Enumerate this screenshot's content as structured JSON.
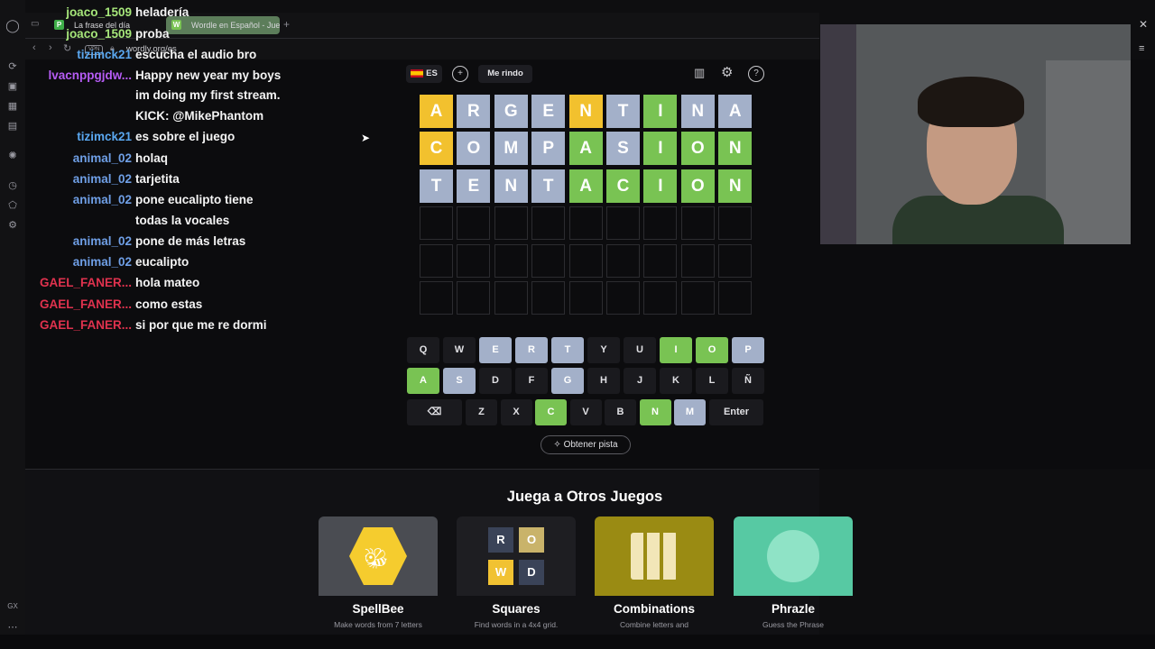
{
  "browser": {
    "tabs": [
      {
        "label": "La frase del día",
        "favicon": "P"
      },
      {
        "label": "Wordle en Español - Juego",
        "favicon": "W"
      }
    ],
    "url": "wordly.org/es",
    "vpn": "VPN",
    "gx": "GX"
  },
  "game": {
    "lang": "ES",
    "giveup": "Me rindo",
    "rows": [
      [
        "A",
        "R",
        "G",
        "E",
        "N",
        "T",
        "I",
        "N",
        "A"
      ],
      [
        "C",
        "O",
        "M",
        "P",
        "A",
        "S",
        "I",
        "O",
        "N"
      ],
      [
        "T",
        "E",
        "N",
        "T",
        "A",
        "C",
        "I",
        "O",
        "N"
      ]
    ],
    "states": [
      [
        "y",
        "g",
        "g",
        "g",
        "y",
        "g",
        "G",
        "g",
        "g"
      ],
      [
        "y",
        "g",
        "g",
        "g",
        "G",
        "g",
        "G",
        "G",
        "G"
      ],
      [
        "g",
        "g",
        "g",
        "g",
        "G",
        "G",
        "G",
        "G",
        "G"
      ]
    ],
    "keyboard": {
      "row1": [
        "Q",
        "W",
        "E",
        "R",
        "T",
        "Y",
        "U",
        "I",
        "O",
        "P"
      ],
      "row2": [
        "A",
        "S",
        "D",
        "F",
        "G",
        "H",
        "J",
        "K",
        "L",
        "Ñ"
      ],
      "row3": [
        "Z",
        "X",
        "C",
        "V",
        "B",
        "N",
        "M"
      ],
      "enter": "Enter"
    },
    "hint": "Obtener pista"
  },
  "other_games": {
    "title": "Juega a Otros Juegos",
    "cards": [
      {
        "name": "SpellBee",
        "desc": "Make words from 7 letters"
      },
      {
        "name": "Squares",
        "desc": "Find words in a 4x4 grid."
      },
      {
        "name": "Combinations",
        "desc": "Combine letters and"
      },
      {
        "name": "Phrazle",
        "desc": "Guess the Phrase"
      }
    ],
    "squares_letters": [
      "R",
      "O",
      "W",
      "D"
    ]
  },
  "chat": [
    {
      "user": "joaco_1509",
      "color": "#a6e67a",
      "text": "heladería"
    },
    {
      "user": "joaco_1509",
      "color": "#a6e67a",
      "text": "proba"
    },
    {
      "user": "tizimck21",
      "color": "#5aa7ef",
      "text": "escucha el audio bro"
    },
    {
      "user": "lvacnppgjdw...",
      "color": "#b65cf5",
      "text": "Happy new year my boys"
    },
    {
      "user": "",
      "color": "#b65cf5",
      "text": "im doing my first stream."
    },
    {
      "user": "",
      "color": "#b65cf5",
      "text": "KICK: @MikePhantom"
    },
    {
      "user": "tizimck21",
      "color": "#5aa7ef",
      "text": "es sobre el juego"
    },
    {
      "user": "animal_02",
      "color": "#6f9fe6",
      "text": "holaq"
    },
    {
      "user": "animal_02",
      "color": "#6f9fe6",
      "text": "tarjetita"
    },
    {
      "user": "animal_02",
      "color": "#6f9fe6",
      "text": "pone eucalipto tiene"
    },
    {
      "user": "",
      "color": "#6f9fe6",
      "text": "todas la vocales"
    },
    {
      "user": "animal_02",
      "color": "#6f9fe6",
      "text": "pone de más letras"
    },
    {
      "user": "animal_02",
      "color": "#6f9fe6",
      "text": "eucalipto"
    },
    {
      "user": "GAEL_FANER...",
      "color": "#e0324e",
      "text": "hola mateo"
    },
    {
      "user": "GAEL_FANER...",
      "color": "#e0324e",
      "text": "como estas"
    },
    {
      "user": "GAEL_FANER...",
      "color": "#e0324e",
      "text": "si por que me re dormi"
    }
  ]
}
